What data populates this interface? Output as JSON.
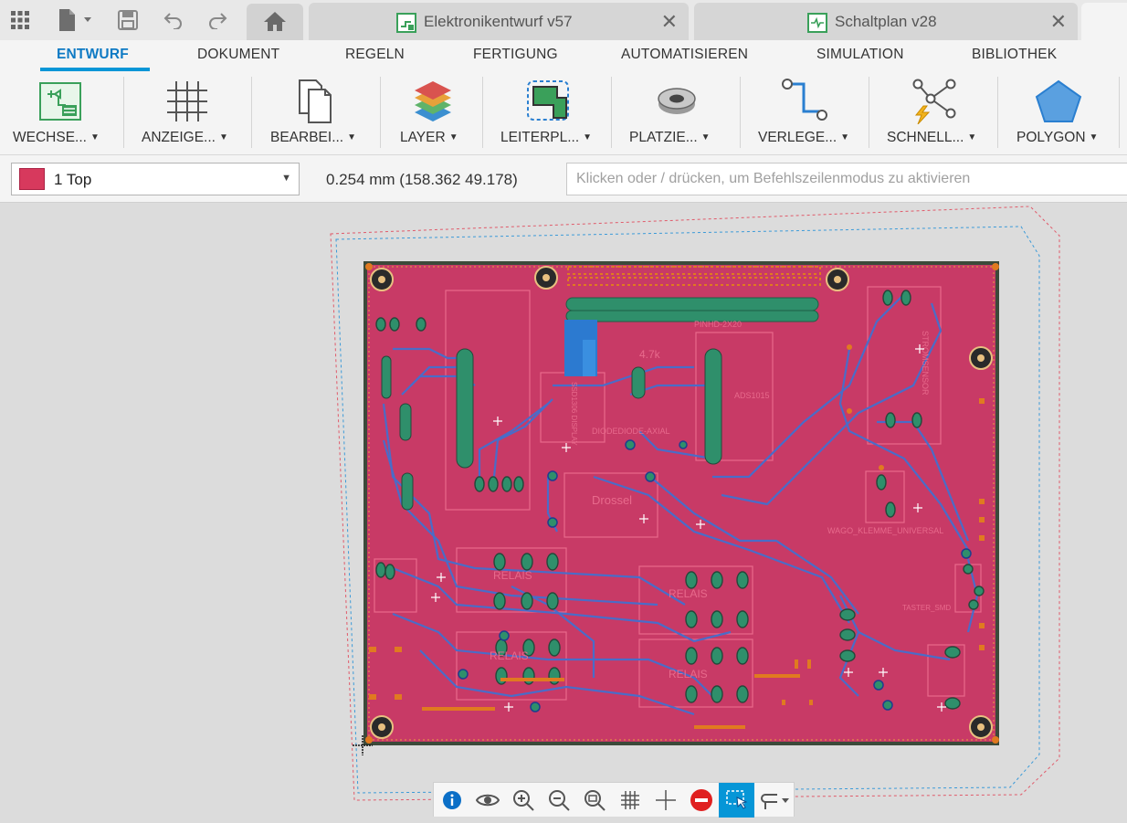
{
  "app": {
    "tabs": [
      {
        "label": "Elektronikentwurf v57",
        "icon": "pcb-document-icon"
      },
      {
        "label": "Schaltplan v28",
        "icon": "schematic-document-icon"
      }
    ]
  },
  "ribbon": {
    "menu_tabs": [
      "ENTWURF",
      "DOKUMENT",
      "REGELN",
      "FERTIGUNG",
      "AUTOMATISIEREN",
      "SIMULATION",
      "BIBLIOTHEK"
    ],
    "active_tab": "ENTWURF",
    "tools": [
      {
        "label": "WECHSE...",
        "icon": "switch-to-schematic-icon"
      },
      {
        "label": "ANZEIGE...",
        "icon": "grid-icon"
      },
      {
        "label": "BEARBEI...",
        "icon": "copy-pages-icon"
      },
      {
        "label": "LAYER",
        "icon": "layers-icon"
      },
      {
        "label": "LEITERPL...",
        "icon": "board-outline-icon"
      },
      {
        "label": "PLATZIE...",
        "icon": "place-component-icon"
      },
      {
        "label": "VERLEGE...",
        "icon": "route-icon"
      },
      {
        "label": "SCHNELL...",
        "icon": "quick-route-icon"
      },
      {
        "label": "POLYGON",
        "icon": "polygon-icon"
      }
    ]
  },
  "command_bar": {
    "layer": {
      "name": "1 Top",
      "color": "#d7395d"
    },
    "coordinates": "0.254 mm (158.362 49.178)",
    "command_placeholder": "Klicken oder / drücken, um Befehlszeilenmodus zu aktivieren"
  },
  "board": {
    "silkscreen_labels": [
      "PINHD-2X20",
      "ADS1015",
      "4.7k",
      "DIODEDIODE-AXIAL",
      "Drossel",
      "RELAIS",
      "RELAIS",
      "RELAIS",
      "RELAIS",
      "WAGO_KLEMME_UNIVERSAL",
      "STROMSENSOR",
      "SSD1306 DISPLAY",
      "TASTER_SMD"
    ],
    "colors": {
      "board": "#c83a66",
      "outline": "#3c4a3a",
      "trace": "#4a6cc8",
      "pad": "#2f8f6b",
      "holes": "#9a6a30"
    }
  },
  "nav_toolbar": {
    "buttons": [
      "info-icon",
      "eye-icon",
      "zoom-in-icon",
      "zoom-out-icon",
      "zoom-fit-icon",
      "grid-icon",
      "crosshair-icon",
      "stop-icon",
      "select-icon",
      "route-options-icon"
    ],
    "active": "select-icon"
  }
}
